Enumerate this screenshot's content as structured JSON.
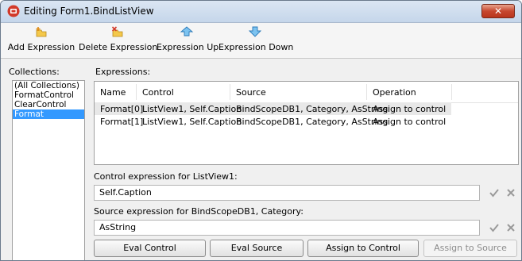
{
  "window": {
    "title": "Editing Form1.BindListView",
    "close_glyph": "✕"
  },
  "toolbar": {
    "buttons": [
      {
        "label": "Add Expression",
        "icon": "add-expression-icon"
      },
      {
        "label": "Delete Expression",
        "icon": "delete-expression-icon"
      },
      {
        "label": "Expression Up",
        "icon": "arrow-up-icon"
      },
      {
        "label": "Expression Down",
        "icon": "arrow-down-icon"
      }
    ]
  },
  "collections": {
    "label": "Collections:",
    "items": [
      "(All Collections)",
      "FormatControl",
      "ClearControl",
      "Format"
    ],
    "selected_index": 3
  },
  "expressions": {
    "label": "Expressions:",
    "columns": [
      "Name",
      "Control",
      "Source",
      "Operation"
    ],
    "rows": [
      {
        "name": "Format[0]",
        "control": "ListView1, Self.Caption",
        "source": "BindScopeDB1, Category, AsString",
        "operation": "Assign to control"
      },
      {
        "name": "Format[1]",
        "control": "ListView1, Self.Caption",
        "source": "BindScopeDB1, Category, AsString",
        "operation": "Assign to control"
      }
    ],
    "selected_row": 0
  },
  "control_expression": {
    "label": "Control expression for ListView1:",
    "value": "Self.Caption"
  },
  "source_expression": {
    "label": "Source expression for BindScopeDB1, Category:",
    "value": "AsString"
  },
  "buttons": {
    "eval_control": "Eval Control",
    "eval_source": "Eval Source",
    "assign_to_control": "Assign to Control",
    "assign_to_source": "Assign to Source"
  },
  "colors": {
    "selection": "#3399ff",
    "row_highlight": "#e8e8e8",
    "close_button": "#c7472f"
  }
}
